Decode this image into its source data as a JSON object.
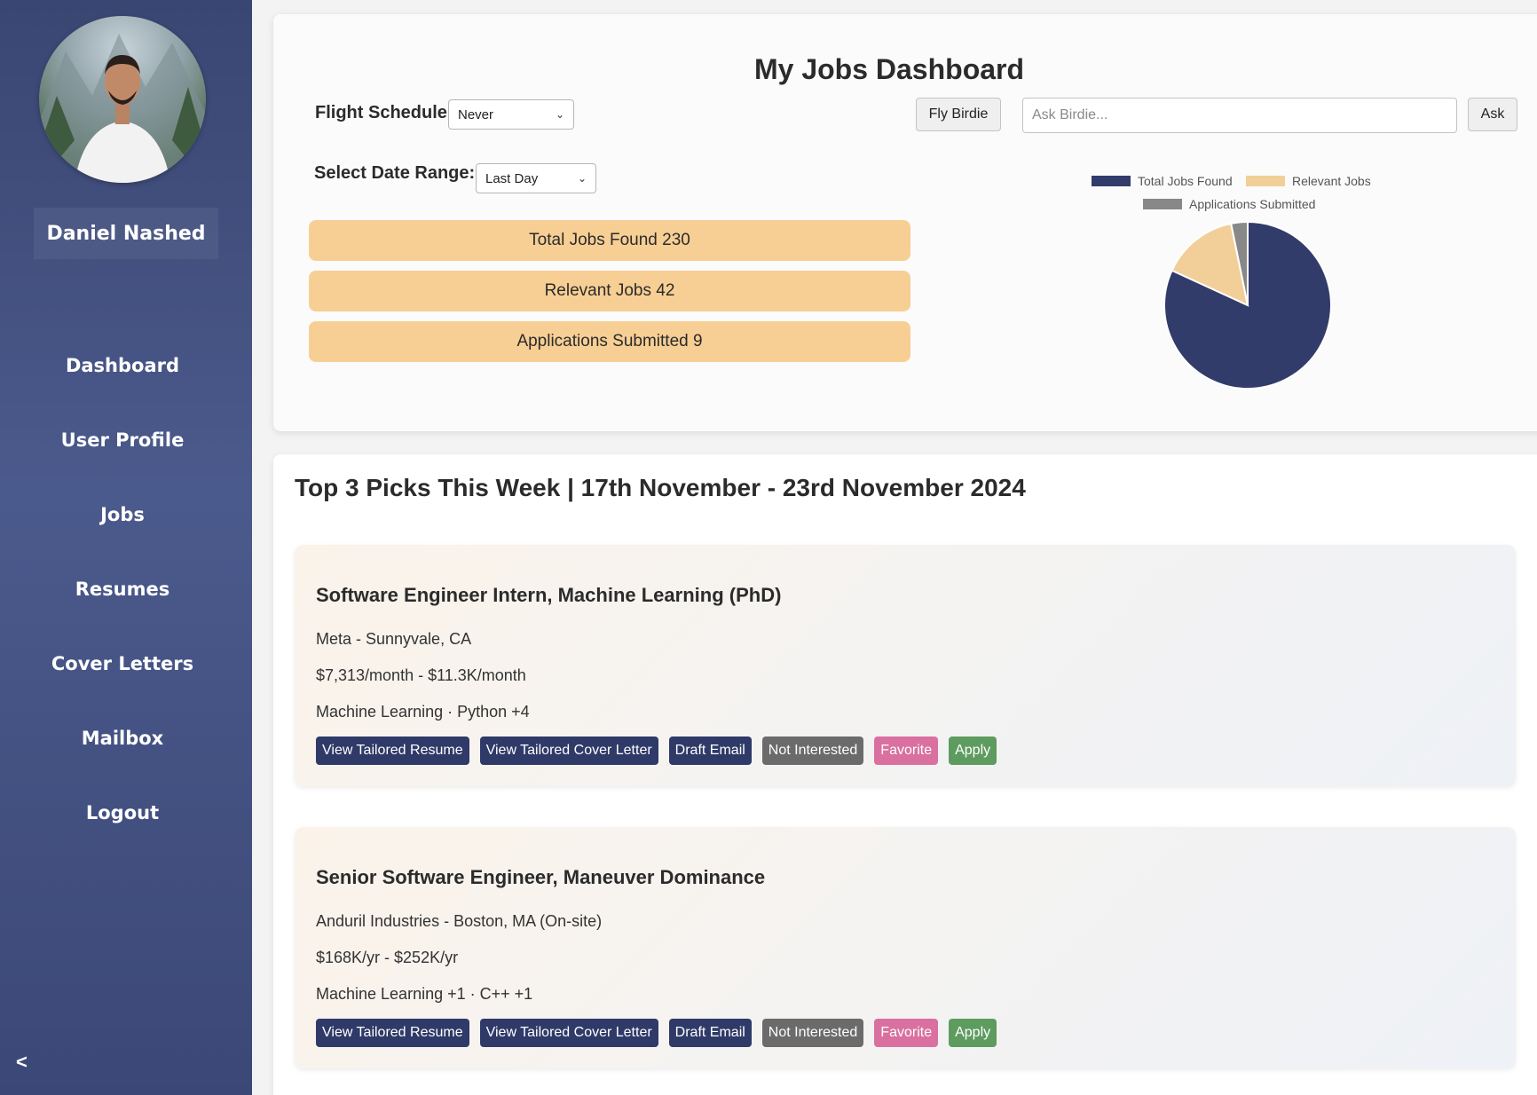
{
  "user": {
    "name": "Daniel Nashed"
  },
  "nav": {
    "items": [
      {
        "label": "Dashboard"
      },
      {
        "label": "User Profile"
      },
      {
        "label": "Jobs"
      },
      {
        "label": "Resumes"
      },
      {
        "label": "Cover Letters"
      },
      {
        "label": "Mailbox"
      },
      {
        "label": "Logout"
      }
    ],
    "collapse_label": "<"
  },
  "dashboard": {
    "title": "My Jobs Dashboard",
    "flight_schedule": {
      "label": "Flight Schedule",
      "value": "Never"
    },
    "date_range": {
      "label": "Select Date Range:",
      "value": "Last Day"
    },
    "fly_button": "Fly Birdie",
    "ask": {
      "placeholder": "Ask Birdie...",
      "button": "Ask"
    },
    "stats": [
      {
        "label": "Total Jobs Found 230"
      },
      {
        "label": "Relevant Jobs 42"
      },
      {
        "label": "Applications Submitted 9"
      }
    ]
  },
  "chart_data": {
    "type": "pie",
    "categories": [
      "Total Jobs Found",
      "Relevant Jobs",
      "Applications Submitted"
    ],
    "values": [
      230,
      42,
      9
    ],
    "colors": [
      "#323c6b",
      "#f2cf98",
      "#888888"
    ],
    "legend": "top"
  },
  "picks": {
    "title": "Top 3 Picks This Week | 17th November - 23rd November 2024",
    "jobs": [
      {
        "title": "Software Engineer Intern, Machine Learning (PhD)",
        "company": "Meta - Sunnyvale, CA",
        "salary": "$7,313/month - $11.3K/month",
        "skills": "Machine Learning · Python +4"
      },
      {
        "title": "Senior Software Engineer, Maneuver Dominance",
        "company": "Anduril Industries - Boston, MA (On-site)",
        "salary": "$168K/yr - $252K/yr",
        "skills": "Machine Learning +1 · C++ +1"
      }
    ],
    "actions": {
      "resume": "View Tailored Resume",
      "cover": "View Tailored Cover Letter",
      "email": "Draft Email",
      "not_interested": "Not Interested",
      "favorite": "Favorite",
      "apply": "Apply"
    }
  },
  "colors": {
    "sidebar": "#3f4b7a",
    "stat_bar": "#f7cf94",
    "navy_button": "#2f3a68",
    "favorite": "#d9709f",
    "apply": "#5e9b5f"
  }
}
